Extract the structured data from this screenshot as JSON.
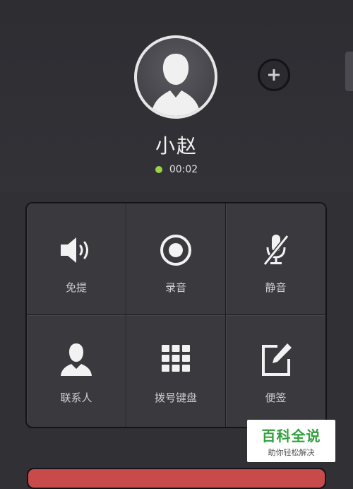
{
  "contact": {
    "name": "小赵",
    "call_timer": "00:02"
  },
  "colors": {
    "online_dot": "#9bd248",
    "end_call": "#c94a4a",
    "watermark_green": "#2fa13a"
  },
  "actions": [
    {
      "label": "免提",
      "icon": "speaker-icon"
    },
    {
      "label": "录音",
      "icon": "record-icon"
    },
    {
      "label": "静音",
      "icon": "mute-mic-icon"
    },
    {
      "label": "联系人",
      "icon": "contact-person-icon"
    },
    {
      "label": "拨号键盘",
      "icon": "dialpad-icon"
    },
    {
      "label": "便签",
      "icon": "note-edit-icon"
    }
  ],
  "add_button_icon": "plus-icon",
  "watermark": {
    "title": "百科全说",
    "subtitle": "助你轻松解决"
  }
}
